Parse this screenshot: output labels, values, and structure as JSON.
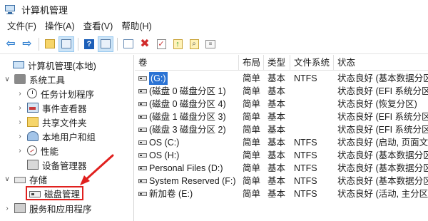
{
  "window": {
    "title": "计算机管理"
  },
  "menu": [
    "文件(F)",
    "操作(A)",
    "查看(V)",
    "帮助(H)"
  ],
  "tree": {
    "root": "计算机管理(本地)",
    "system_tools": "系统工具",
    "task_scheduler": "任务计划程序",
    "event_viewer": "事件查看器",
    "shared_folders": "共享文件夹",
    "local_users": "本地用户和组",
    "performance": "性能",
    "device_manager": "设备管理器",
    "storage": "存储",
    "disk_management": "磁盘管理",
    "services": "服务和应用程序"
  },
  "columns": [
    "卷",
    "布局",
    "类型",
    "文件系统",
    "状态"
  ],
  "rows": [
    {
      "volume": "(G:)",
      "layout": "简单",
      "type": "基本",
      "fs": "NTFS",
      "status": "状态良好 (基本数据分区"
    },
    {
      "volume": "(磁盘 0 磁盘分区 1)",
      "layout": "简单",
      "type": "基本",
      "fs": "",
      "status": "状态良好 (EFI 系统分区"
    },
    {
      "volume": "(磁盘 0 磁盘分区 4)",
      "layout": "简单",
      "type": "基本",
      "fs": "",
      "status": "状态良好 (恢复分区)"
    },
    {
      "volume": "(磁盘 1 磁盘分区 3)",
      "layout": "简单",
      "type": "基本",
      "fs": "",
      "status": "状态良好 (EFI 系统分区"
    },
    {
      "volume": "(磁盘 3 磁盘分区 2)",
      "layout": "简单",
      "type": "基本",
      "fs": "",
      "status": "状态良好 (EFI 系统分区"
    },
    {
      "volume": "OS (C:)",
      "layout": "简单",
      "type": "基本",
      "fs": "NTFS",
      "status": "状态良好 (启动, 页面文件"
    },
    {
      "volume": "OS (H:)",
      "layout": "简单",
      "type": "基本",
      "fs": "NTFS",
      "status": "状态良好 (基本数据分区"
    },
    {
      "volume": "Personal Files (D:)",
      "layout": "简单",
      "type": "基本",
      "fs": "NTFS",
      "status": "状态良好 (基本数据分区"
    },
    {
      "volume": "System Reserved (F:)",
      "layout": "简单",
      "type": "基本",
      "fs": "NTFS",
      "status": "状态良好 (基本数据分区"
    },
    {
      "volume": "新加卷 (E:)",
      "layout": "简单",
      "type": "基本",
      "fs": "NTFS",
      "status": "状态良好 (活动, 主分区)"
    }
  ],
  "colors": {
    "annotation": "#e0201e",
    "selection": "#2b73d4"
  }
}
